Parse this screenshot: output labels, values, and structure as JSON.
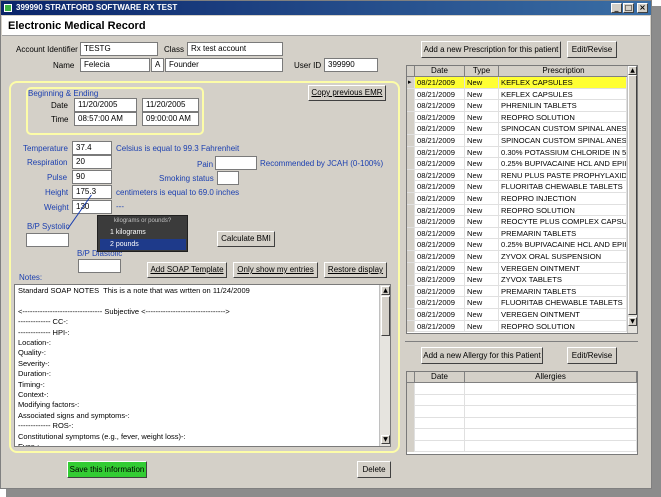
{
  "window": {
    "title": "399990 STRATFORD SOFTWARE RX TEST",
    "controls": {
      "minimize": "_",
      "maximize": "□",
      "close": "×"
    }
  },
  "header": {
    "title": "Electronic Medical Record"
  },
  "patient": {
    "account_identifier_label": "Account Identifier",
    "account_identifier": "TESTG",
    "class_label": "Class",
    "class_value": "Rx test account",
    "name_label": "Name",
    "first_name": "Felecia",
    "middle_initial": "A",
    "last_name": "Founder",
    "user_id_label": "User ID",
    "user_id": "399990"
  },
  "encounter": {
    "group_label": "Beginning & Ending",
    "date_label": "Date",
    "start_date": "11/20/2005",
    "end_date": "11/20/2005",
    "time_label": "Time",
    "start_time": "08:57:00 AM",
    "end_time": "09:00:00 AM",
    "copy_button": "Copy previous EMR"
  },
  "vitals": {
    "temperature_label": "Temperature",
    "temperature": "37.4",
    "temperature_note": "Celsius is equal to 99.3 Fahrenheit",
    "respiration_label": "Respiration",
    "respiration": "20",
    "pain_label": "Pain",
    "pain": "",
    "pain_note": "Recommended by JCAH (0-100%)",
    "pulse_label": "Pulse",
    "pulse": "90",
    "smoking_label": "Smoking status",
    "smoking": "",
    "height_label": "Height",
    "height": "175.3",
    "height_note": "centimeters is equal to 69.0 inches",
    "weight_label": "Weight",
    "weight": "130",
    "weight_unit": "---",
    "bp_systolic_label": "B/P Systolic",
    "bp_systolic": "",
    "bp_diastolic_label": "B/P Diastolic",
    "bp_diastolic": "",
    "calc_bmi_button": "Calculate BMI"
  },
  "unit_popup": {
    "hint": "kilograms or pounds?",
    "options": [
      "1 kilograms",
      "2 pounds"
    ],
    "selected_index": 1
  },
  "notes": {
    "label": "Notes:",
    "add_soap_button": "Add SOAP Template",
    "only_mine_button": "Only show my entries",
    "restore_button": "Restore display",
    "text": "Standard SOAP NOTES  This is a note that was wrtten on 11/24/2009\n\n<-------------------------------- Subjective <-------------------------------->\n------------- CC-:\n------------- HPI-:\nLocation-:\nQuality-:\nSeverity-:\nDuration-:\nTiming-:\nContext-:\nModifying factors-:\nAssociated signs and symptoms-:\n------------- ROS-:\nConstitutional symptoms (e.g., fever, weight loss)-:\nEyes-:\nEars, nose, mouth and throat-:"
  },
  "footer": {
    "save_button": "Save this information",
    "delete_button": "Delete"
  },
  "prescriptions": {
    "add_button": "Add a new Prescription for this patient",
    "edit_button": "Edit/Revise",
    "columns": [
      "Date",
      "Type",
      "Prescription"
    ],
    "rows": [
      {
        "date": "08/21/2009",
        "type": "New",
        "rx": "KEFLEX CAPSULES"
      },
      {
        "date": "08/21/2009",
        "type": "New",
        "rx": "KEFLEX CAPSULES"
      },
      {
        "date": "08/21/2009",
        "type": "New",
        "rx": "PHRENILIN TABLETS"
      },
      {
        "date": "08/21/2009",
        "type": "New",
        "rx": "REOPRO SOLUTION"
      },
      {
        "date": "08/21/2009",
        "type": "New",
        "rx": "SPINOCAN CUSTOM SPINAL ANES"
      },
      {
        "date": "08/21/2009",
        "type": "New",
        "rx": "SPINOCAN CUSTOM SPINAL ANES"
      },
      {
        "date": "08/21/2009",
        "type": "New",
        "rx": "0.30% POTASSIUM CHLORIDE IN 5"
      },
      {
        "date": "08/21/2009",
        "type": "New",
        "rx": "0.25% BUPIVACAINE HCL AND EPII"
      },
      {
        "date": "08/21/2009",
        "type": "New",
        "rx": "RENU PLUS PASTE PROPHYLAXID"
      },
      {
        "date": "08/21/2009",
        "type": "New",
        "rx": "FLUORITAB CHEWABLE TABLETS"
      },
      {
        "date": "08/21/2009",
        "type": "New",
        "rx": "REOPRO INJECTION"
      },
      {
        "date": "08/21/2009",
        "type": "New",
        "rx": "REOPRO SOLUTION"
      },
      {
        "date": "08/21/2009",
        "type": "New",
        "rx": "REOCYTE PLUS COMPLEX CAPSU"
      },
      {
        "date": "08/21/2009",
        "type": "New",
        "rx": "PREMARIN TABLETS"
      },
      {
        "date": "08/21/2009",
        "type": "New",
        "rx": "0.25% BUPIVACAINE HCL AND EPII"
      },
      {
        "date": "08/21/2009",
        "type": "New",
        "rx": "ZYVOX ORAL SUSPENSION"
      },
      {
        "date": "08/21/2009",
        "type": "New",
        "rx": "VEREGEN OINTMENT"
      },
      {
        "date": "08/21/2009",
        "type": "New",
        "rx": "ZYVOX TABLETS"
      },
      {
        "date": "08/21/2009",
        "type": "New",
        "rx": "PREMARIN TABLETS"
      },
      {
        "date": "08/21/2009",
        "type": "New",
        "rx": "FLUORITAB CHEWABLE TABLETS"
      },
      {
        "date": "08/21/2009",
        "type": "New",
        "rx": "VEREGEN OINTMENT"
      },
      {
        "date": "08/21/2009",
        "type": "New",
        "rx": "REOPRO SOLUTION"
      }
    ],
    "selected_row": 0
  },
  "allergies": {
    "add_button": "Add a new Allergy for this Patient",
    "edit_button": "Edit/Revise",
    "columns": [
      "Date",
      "Allergies"
    ]
  },
  "colors": {
    "highlight": "#fdfda8",
    "selection": "#ffff33",
    "save_button": "#33cc33",
    "title_bar": "#0a246a"
  }
}
